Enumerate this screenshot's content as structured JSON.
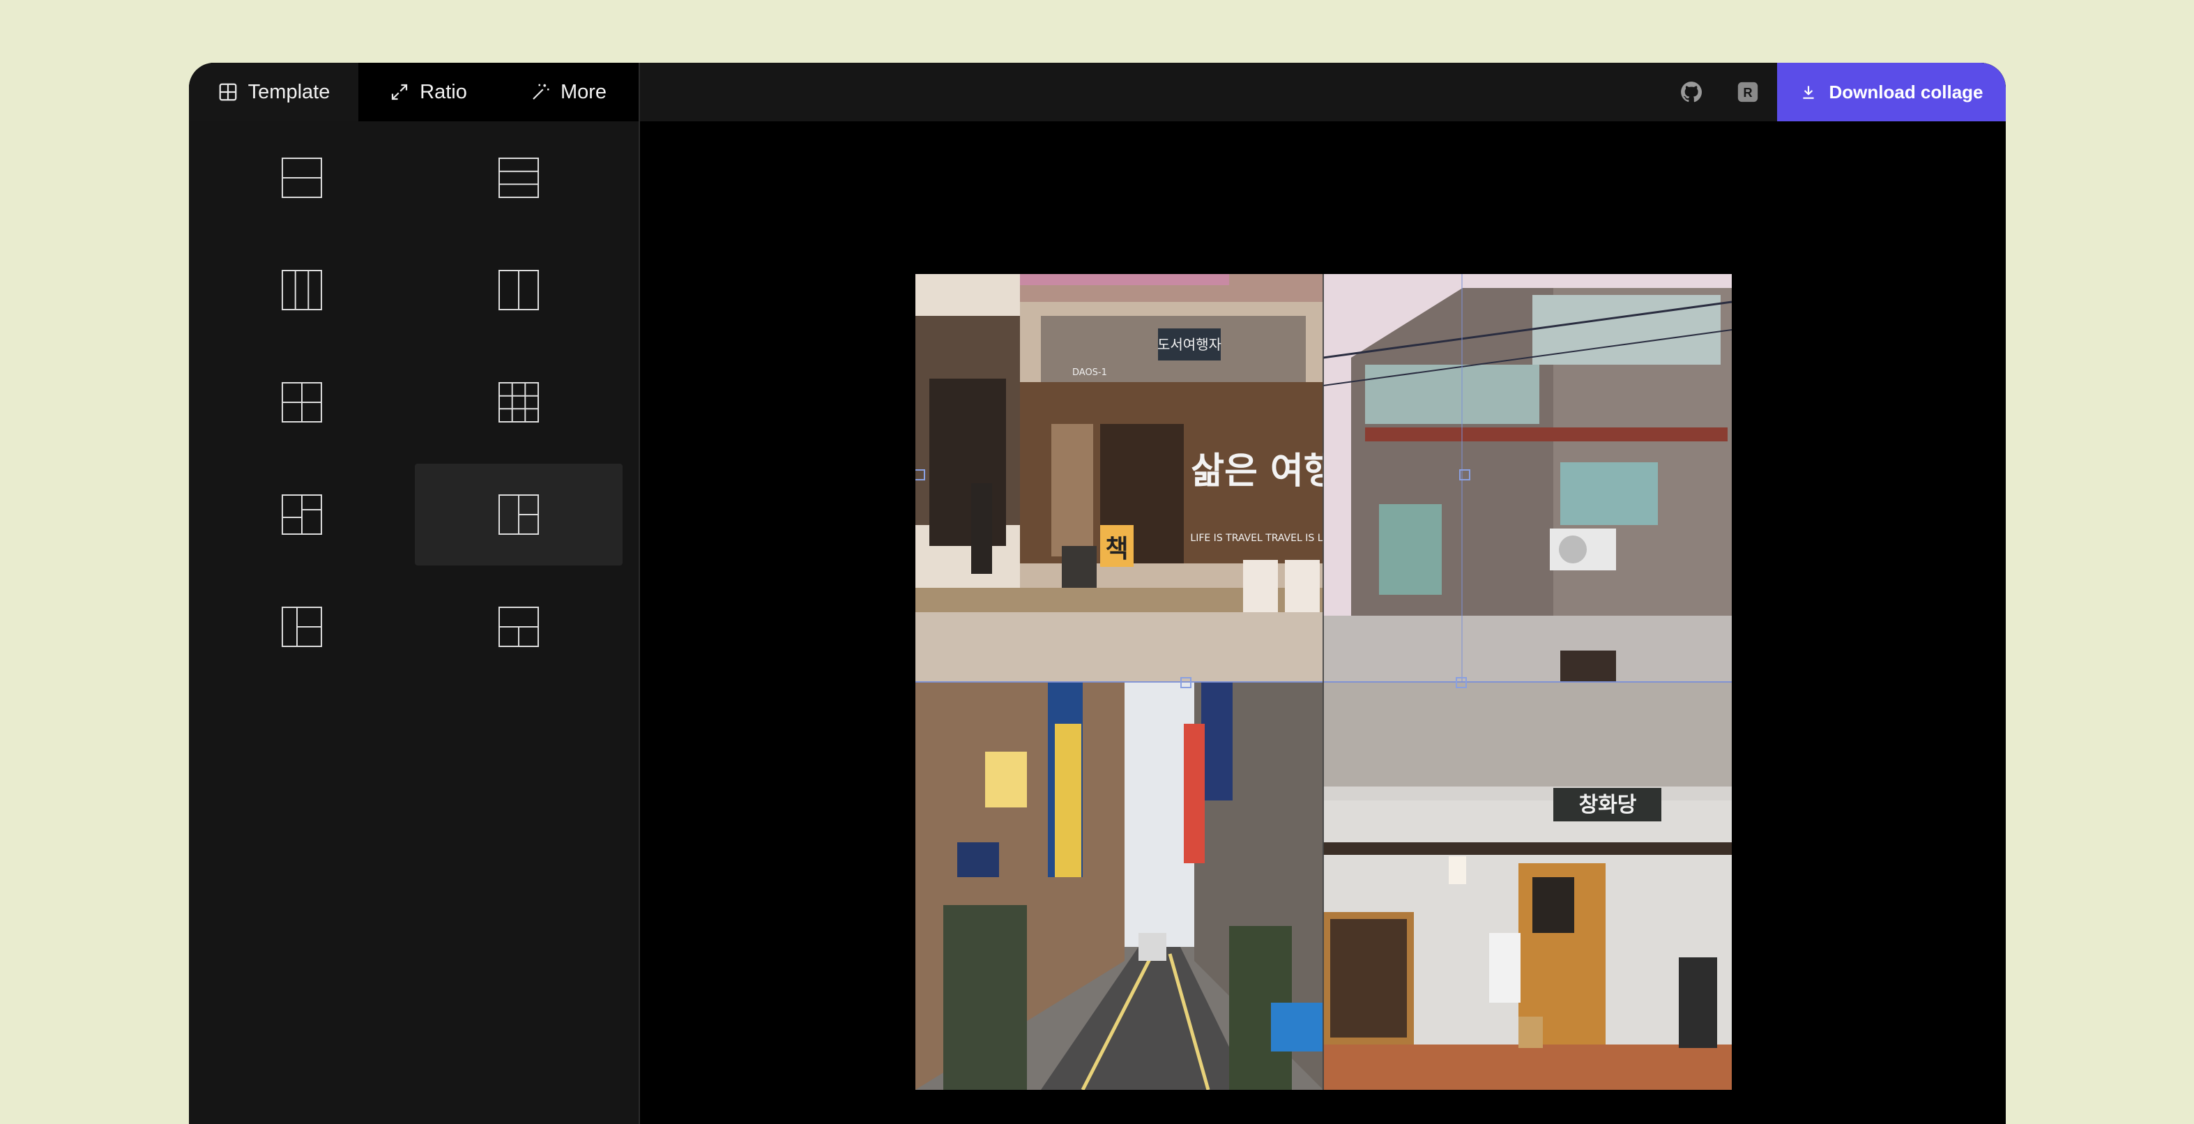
{
  "toolbar": {
    "tabs": [
      {
        "label": "Template",
        "icon": "grid-icon"
      },
      {
        "label": "Ratio",
        "icon": "expand-icon"
      },
      {
        "label": "More",
        "icon": "magic-wand-icon"
      }
    ],
    "github_icon": "github-icon",
    "r_icon": "r-badge-icon",
    "r_letter": "R",
    "download_label": "Download collage",
    "accent": "#5b4de8"
  },
  "templates": {
    "selected_index": 7,
    "items": [
      {
        "name": "two-rows"
      },
      {
        "name": "three-rows"
      },
      {
        "name": "three-columns"
      },
      {
        "name": "two-columns"
      },
      {
        "name": "grid-2x2"
      },
      {
        "name": "grid-3x3"
      },
      {
        "name": "left-split-right-full"
      },
      {
        "name": "left-full-right-split"
      },
      {
        "name": "left-full-right-split-tall"
      },
      {
        "name": "top-full-bottom-split"
      }
    ]
  },
  "collage": {
    "photo_1": {
      "sign_top": "도서여행자",
      "sign_side": "삶은 여행",
      "sign_en": "LIFE IS TRAVEL TRAVEL IS LIFE",
      "small": "DAOS-1",
      "letter": "책"
    },
    "photo_4": {
      "sign": "창화당"
    }
  }
}
